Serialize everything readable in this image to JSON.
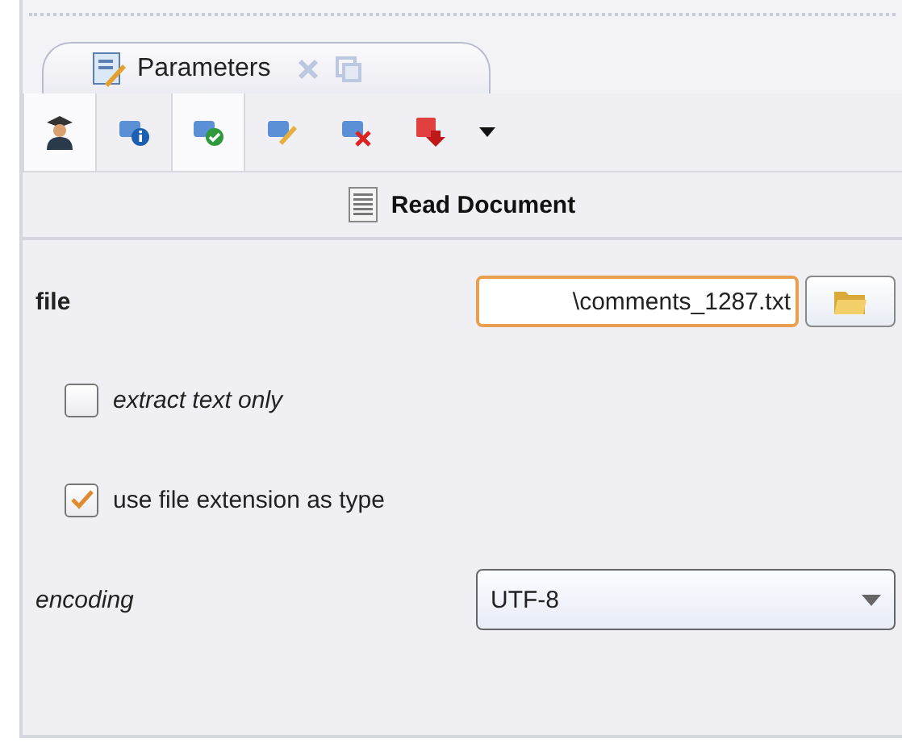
{
  "tab": {
    "title": "Parameters",
    "selected": true
  },
  "toolbar": {
    "buttons": [
      {
        "kind": "expert",
        "selected": true
      },
      {
        "kind": "info",
        "selected": false
      },
      {
        "kind": "apply",
        "selected": true
      },
      {
        "kind": "edit",
        "selected": false
      },
      {
        "kind": "remove",
        "selected": false
      },
      {
        "kind": "import",
        "selected": false
      }
    ]
  },
  "operator": {
    "title": "Read Document"
  },
  "parameters": [
    {
      "kind": "file",
      "label": "file",
      "required": true,
      "expert": false,
      "value": "\\comments_1287.txt",
      "focused": true
    },
    {
      "kind": "checkbox",
      "label": "extract text only",
      "required": false,
      "expert": true,
      "checked": false
    },
    {
      "kind": "checkbox",
      "label": "use file extension as type",
      "required": false,
      "expert": false,
      "checked": true
    },
    {
      "kind": "select",
      "label": "encoding",
      "required": false,
      "expert": true,
      "value": "UTF-8"
    }
  ]
}
